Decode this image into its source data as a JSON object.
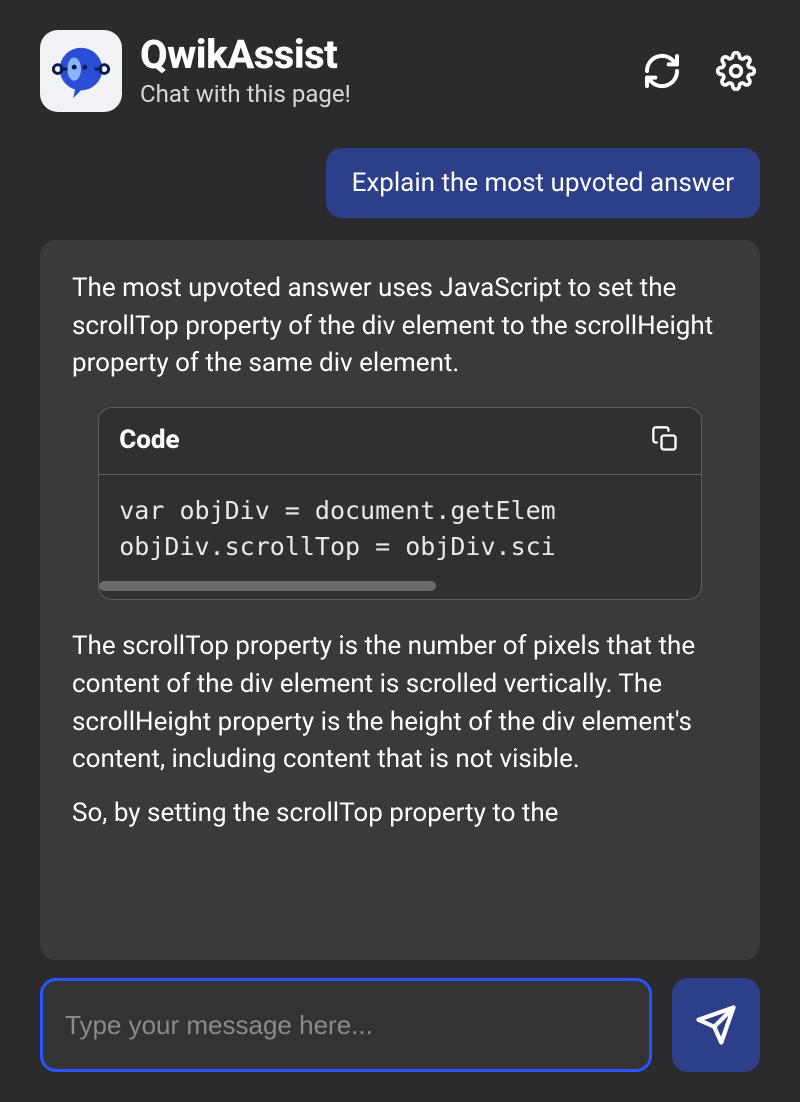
{
  "header": {
    "title": "QwikAssist",
    "subtitle": "Chat with this page!",
    "refresh_icon": "refresh-icon",
    "settings_icon": "gear-icon"
  },
  "chat": {
    "user_message": "Explain the most upvoted answer",
    "assistant": {
      "para1": "The most upvoted answer uses JavaScript to set the scrollTop property of the div element to the scrollHeight property of the same div element.",
      "code_label": "Code",
      "code_lines": [
        "var objDiv = document.getElem",
        "objDiv.scrollTop = objDiv.sci"
      ],
      "para2": "The scrollTop property is the number of pixels that the content of the div element is scrolled vertically. The scrollHeight property is the height of the div element's content, including content that is not visible.",
      "para3": "So, by setting the scrollTop property to the"
    }
  },
  "input": {
    "placeholder": "Type your message here..."
  }
}
